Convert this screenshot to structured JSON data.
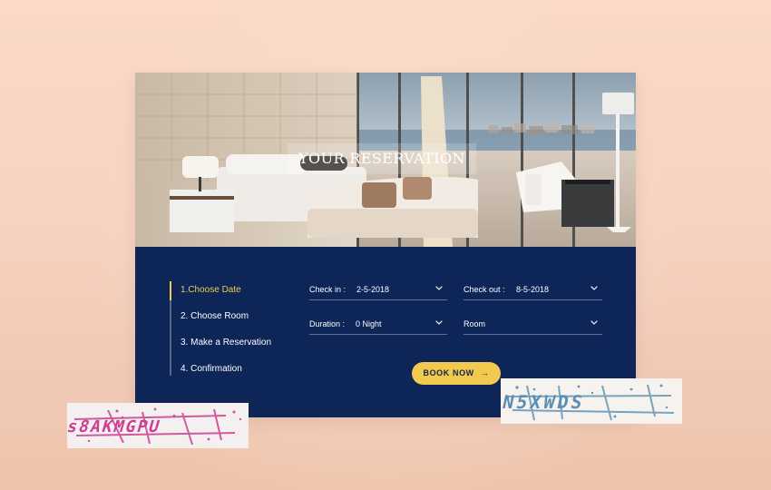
{
  "hero": {
    "title": "YOUR RESERVATION"
  },
  "steps": [
    {
      "label": "1.Choose Date",
      "active": true
    },
    {
      "label": "2. Choose Room",
      "active": false
    },
    {
      "label": "3. Make a Reservation",
      "active": false
    },
    {
      "label": "4. Confirmation",
      "active": false
    }
  ],
  "form": {
    "check_in": {
      "label": "Check in :",
      "value": "2-5-2018"
    },
    "check_out": {
      "label": "Check out :",
      "value": "8-5-2018"
    },
    "duration": {
      "label": "Duration :",
      "value": "0 Night"
    },
    "room": {
      "label": "Room",
      "value": ""
    },
    "book_now": "BOOK NOW",
    "book_arrow": "→"
  },
  "captchas": {
    "left_text": "s8AKMGPU",
    "right_text": "N5XWDS"
  },
  "colors": {
    "accent": "#f1c94e",
    "card_bg": "#0d2657",
    "left_captcha_text": "#cc3f93",
    "right_captcha_text": "#5a8fb3"
  }
}
